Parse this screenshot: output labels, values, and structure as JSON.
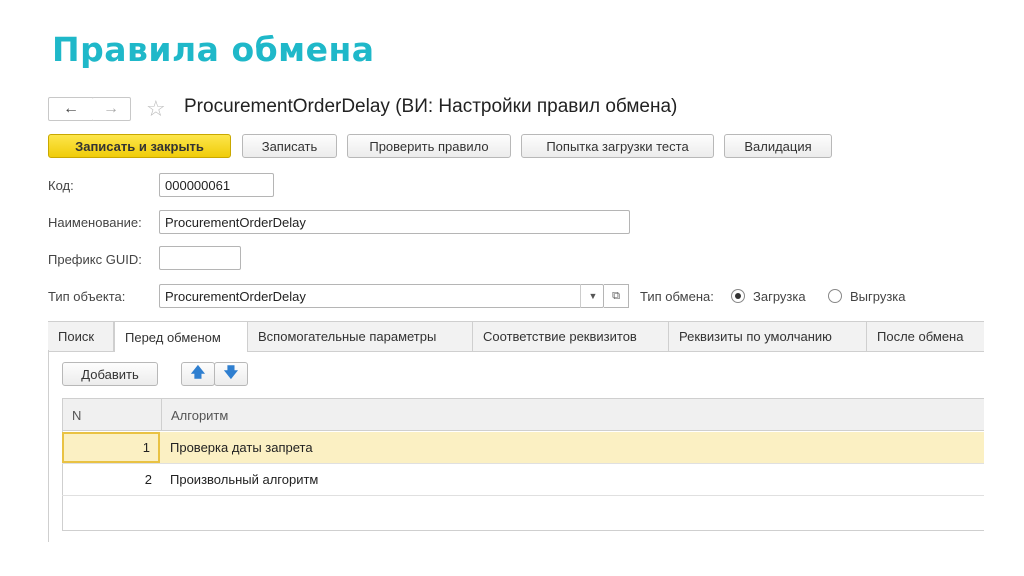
{
  "slide_title": "Правила обмена",
  "window": {
    "back_icon": "arrow-left-icon",
    "forward_icon": "arrow-right-icon",
    "favorite_icon": "star-icon",
    "title": "ProcurementOrderDelay (ВИ: Настройки правил обмена)"
  },
  "toolbar": {
    "save_close": "Записать и закрыть",
    "save": "Записать",
    "check_rule": "Проверить правило",
    "test_load": "Попытка загрузки теста",
    "validation": "Валидация"
  },
  "form": {
    "code_label": "Код:",
    "code_value": "000000061",
    "name_label": "Наименование:",
    "name_value": "ProcurementOrderDelay",
    "guid_label": "Префикс GUID:",
    "guid_value": "",
    "object_type_label": "Тип объекта:",
    "object_type_value": "ProcurementOrderDelay",
    "exchange_type_label": "Тип обмена:",
    "exchange_options": [
      "Загрузка",
      "Выгрузка"
    ],
    "exchange_selected": "Загрузка"
  },
  "tabs": [
    "Поиск",
    "Перед обменом",
    "Вспомогательные параметры",
    "Соответствие реквизитов",
    "Реквизиты по умолчанию",
    "После обмена"
  ],
  "active_tab": "Перед обменом",
  "panel": {
    "add_button": "Добавить",
    "up_icon": "arrow-up-icon",
    "down_icon": "arrow-down-icon",
    "columns": [
      "N",
      "Алгоритм"
    ],
    "rows": [
      {
        "n": "1",
        "algorithm": "Проверка даты запрета",
        "selected": true
      },
      {
        "n": "2",
        "algorithm": "Произвольный алгоритм",
        "selected": false
      }
    ]
  },
  "colors": {
    "accent": "#1fb8c9",
    "primary_button": "#f6d824",
    "selected_row": "#fbf0c3"
  }
}
